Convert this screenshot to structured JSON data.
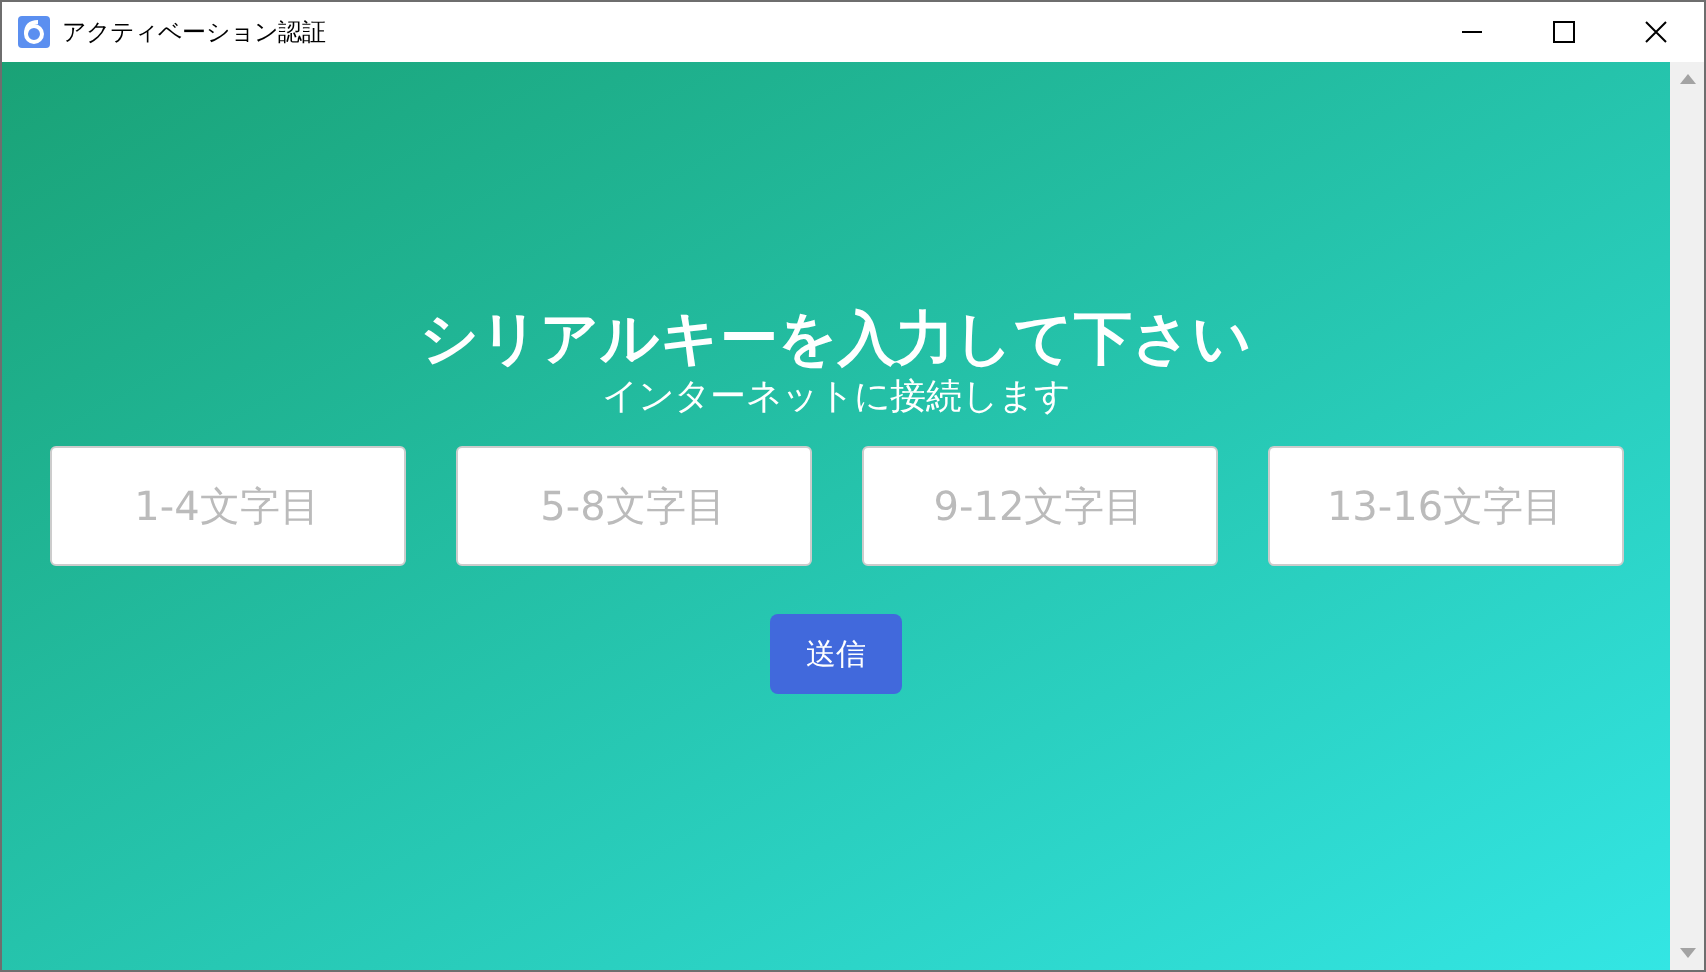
{
  "window": {
    "title": "アクティベーション認証"
  },
  "heading": "シリアルキーを入力して下さい",
  "subheading": "インターネットに接続します",
  "fields": [
    {
      "placeholder": "1-4文字目"
    },
    {
      "placeholder": "5-8文字目"
    },
    {
      "placeholder": "9-12文字目"
    },
    {
      "placeholder": "13-16文字目"
    }
  ],
  "submit_button": "送信"
}
